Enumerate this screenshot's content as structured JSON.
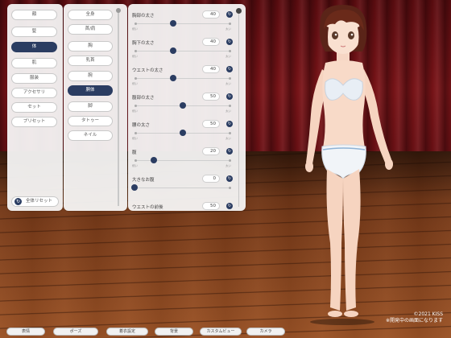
{
  "categories": [
    {
      "label": "顔",
      "active": false
    },
    {
      "label": "髪",
      "active": false
    },
    {
      "label": "体",
      "active": true
    },
    {
      "label": "肌",
      "active": false
    },
    {
      "label": "服装",
      "active": false
    },
    {
      "label": "アクセサリ",
      "active": false
    },
    {
      "label": "セット",
      "active": false
    },
    {
      "label": "プリセット",
      "active": false
    }
  ],
  "reset_all_label": "全体リセット",
  "subcategories": [
    {
      "label": "全身",
      "active": false
    },
    {
      "label": "首/肩",
      "active": false
    },
    {
      "label": "胸",
      "active": false
    },
    {
      "label": "乳首",
      "active": false
    },
    {
      "label": "腕",
      "active": false
    },
    {
      "label": "胴体",
      "active": true
    },
    {
      "label": "脚",
      "active": false
    },
    {
      "label": "タトゥー",
      "active": false
    },
    {
      "label": "ネイル",
      "active": false
    }
  ],
  "sliders": [
    {
      "label": "胸部の太さ",
      "value": "40",
      "level": 0.4,
      "min_label": "細い",
      "max_label": "太い"
    },
    {
      "label": "胸下の太さ",
      "value": "40",
      "level": 0.4,
      "min_label": "細い",
      "max_label": "太い"
    },
    {
      "label": "ウエストの太さ",
      "value": "40",
      "level": 0.4,
      "min_label": "細い",
      "max_label": "太い"
    },
    {
      "label": "腹部の太さ",
      "value": "50",
      "level": 0.5,
      "min_label": "細い",
      "max_label": "太い"
    },
    {
      "label": "腰の太さ",
      "value": "50",
      "level": 0.5,
      "min_label": "細い",
      "max_label": "太い"
    },
    {
      "label": "腹",
      "value": "20",
      "level": 0.2,
      "min_label": "細い",
      "max_label": "太い"
    },
    {
      "label": "大きなお腹",
      "value": "0",
      "level": 0.0,
      "min_label": "",
      "max_label": ""
    },
    {
      "label": "ウエストの前後",
      "value": "50",
      "level": 0.5,
      "min_label": "",
      "max_label": ""
    }
  ],
  "toolbar": [
    "表情",
    "ポーズ",
    "着衣設定",
    "背景",
    "カスタムビュー",
    "カメラ"
  ],
  "credit": {
    "copyright": "©2021 KISS",
    "note": "※開発中の画面になります"
  },
  "colors": {
    "accent": "#2b3d62",
    "curtain": "#7b1418",
    "floor": "#7a3c1a"
  }
}
